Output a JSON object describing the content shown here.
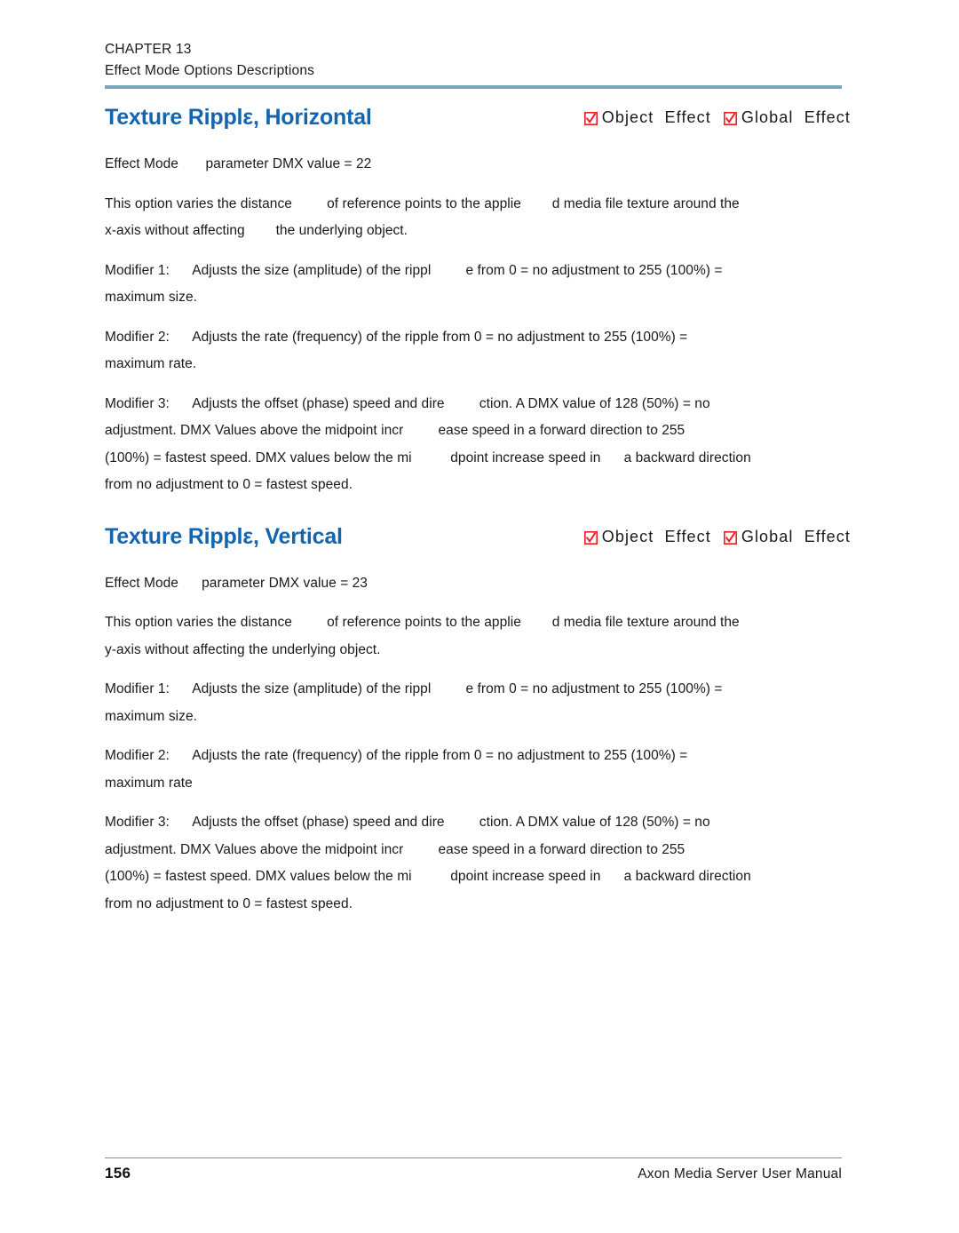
{
  "header": {
    "chapter": "CHAPTER 13",
    "subtitle": "Effect Mode Options Descriptions"
  },
  "colors": {
    "heading_blue": "#1465b0",
    "checkbox_red": "#ed1c24",
    "header_rule": "#7ba7ba",
    "footer_rule": "#8c8c8c"
  },
  "sections": [
    {
      "title": "Texture Ripplε, Horizontal",
      "flags": [
        {
          "label": "Object  Effect",
          "checked": true,
          "icon": "checked-checkbox-icon"
        },
        {
          "label": "Global  Effect",
          "checked": true,
          "icon": "checked-checkbox-icon"
        }
      ],
      "effect_mode_line": "Effect Mode       parameter DMX value = 22",
      "paragraphs": [
        {
          "lines": [
            "This option varies the distance         of reference points to the applie        d media file texture around the",
            "x-axis without affecting        the underlying object."
          ]
        },
        {
          "lines": [
            "Modifier 1:      Adjusts the size (amplitude) of the rippl         e from 0 = no adjustment to 255 (100%) =",
            "maximum size."
          ]
        },
        {
          "lines": [
            "Modifier 2:      Adjusts the rate (frequency) of the ripple from 0 = no adjustment to 255 (100%) =",
            "maximum rate."
          ]
        },
        {
          "lines": [
            "Modifier 3:      Adjusts the offset (phase) speed and dire         ction. A DMX value of 128 (50%) = no",
            "adjustment. DMX Values above the midpoint incr         ease speed in a forward direction to 255",
            "(100%) = fastest speed. DMX values below the mi          dpoint increase speed in      a backward direction",
            "from no adjustment to 0 = fastest speed."
          ]
        }
      ]
    },
    {
      "title": "Texture Ripplε, Vertical",
      "flags": [
        {
          "label": "Object  Effect",
          "checked": true,
          "icon": "checked-checkbox-icon"
        },
        {
          "label": "Global  Effect",
          "checked": true,
          "icon": "checked-checkbox-icon"
        }
      ],
      "effect_mode_line": "Effect Mode      parameter DMX value = 23",
      "paragraphs": [
        {
          "lines": [
            "This option varies the distance         of reference points to the applie        d media file texture around the",
            "y-axis without affecting the underlying object."
          ]
        },
        {
          "lines": [
            "Modifier 1:      Adjusts the size (amplitude) of the rippl         e from 0 = no adjustment to 255 (100%) =",
            "maximum size."
          ]
        },
        {
          "lines": [
            "Modifier 2:      Adjusts the rate (frequency) of the ripple from 0 = no adjustment to 255 (100%) =",
            "maximum rate"
          ]
        },
        {
          "lines": [
            "Modifier 3:      Adjusts the offset (phase) speed and dire         ction. A DMX value of 128 (50%) = no",
            "adjustment. DMX Values above the midpoint incr         ease speed in a forward direction to 255",
            "(100%) = fastest speed. DMX values below the mi          dpoint increase speed in      a backward direction",
            "from no adjustment to 0 = fastest speed."
          ]
        }
      ]
    }
  ],
  "footer": {
    "page_number": "156",
    "manual_title": "Axon Media Server User Manual"
  }
}
